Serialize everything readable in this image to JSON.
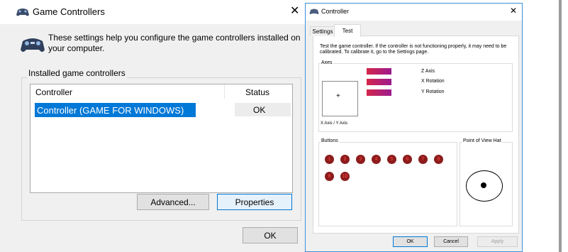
{
  "game_controllers": {
    "title": "Game Controllers",
    "close": "✕",
    "description": "These settings help you configure the game controllers installed on your computer.",
    "group_label": "Installed game controllers",
    "columns": [
      "Controller",
      "Status"
    ],
    "rows": [
      {
        "name": "Controller (GAME FOR WINDOWS)",
        "status": "OK"
      }
    ],
    "buttons": {
      "advanced": "Advanced...",
      "properties": "Properties",
      "ok": "OK"
    }
  },
  "controller_window": {
    "title": "Controller",
    "close": "✕",
    "tabs": [
      "Settings",
      "Test"
    ],
    "instructions": "Test the game controller.  If the controller is not functioning properly, it may need to be calibrated.  To calibrate it, go to the Settings page.",
    "axes": {
      "label": "Axes",
      "xy_label": "X Axis / Y Axis",
      "xy_marker": "+",
      "bars": [
        "Z Axis",
        "X Rotation",
        "Y Rotation"
      ]
    },
    "buttons_section": {
      "label": "Buttons",
      "items": [
        "1",
        "2",
        "3",
        "4",
        "5",
        "6",
        "7",
        "8",
        "9",
        "10"
      ]
    },
    "pov": {
      "label": "Point of View Hat"
    },
    "dialog_buttons": {
      "ok": "OK",
      "cancel": "Cancel",
      "apply": "Apply"
    }
  },
  "colors": {
    "selection": "#0078d7",
    "axis_bar_start": "#d4264a",
    "axis_bar_end": "#9c1b8e",
    "controller_button": "#8c1c1c"
  }
}
